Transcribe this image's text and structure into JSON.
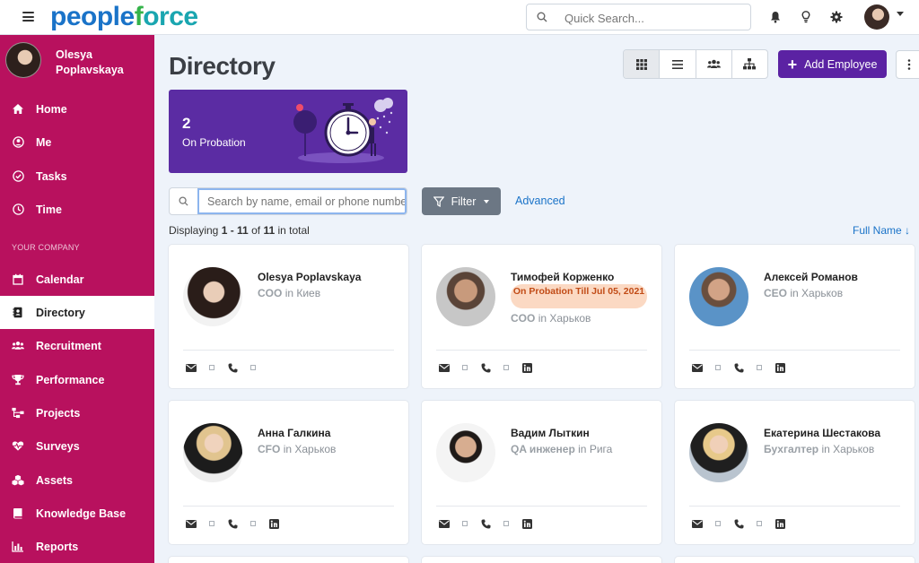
{
  "app": {
    "logo_part1": "people",
    "logo_o": "f",
    "logo_part2": "orce",
    "search_placeholder": "Quick Search..."
  },
  "sidebar": {
    "user_name": "Olesya Poplavskaya",
    "section_label": "YOUR COMPANY",
    "items": [
      {
        "label": "Home",
        "icon": "home-icon"
      },
      {
        "label": "Me",
        "icon": "user-circle-icon"
      },
      {
        "label": "Tasks",
        "icon": "check-circle-icon"
      },
      {
        "label": "Time",
        "icon": "clock-icon"
      },
      {
        "label": "Calendar",
        "icon": "calendar-icon"
      },
      {
        "label": "Directory",
        "icon": "address-book-icon",
        "active": true
      },
      {
        "label": "Recruitment",
        "icon": "users-icon"
      },
      {
        "label": "Performance",
        "icon": "trophy-icon"
      },
      {
        "label": "Projects",
        "icon": "sitemap-icon"
      },
      {
        "label": "Surveys",
        "icon": "heartbeat-icon"
      },
      {
        "label": "Assets",
        "icon": "cubes-icon"
      },
      {
        "label": "Knowledge Base",
        "icon": "book-icon"
      },
      {
        "label": "Reports",
        "icon": "bar-chart-icon"
      }
    ]
  },
  "main": {
    "title": "Directory",
    "add_employee_label": "Add Employee",
    "probation": {
      "count": "2",
      "label": "On Probation"
    },
    "search_placeholder": "Search by name, email or phone number",
    "filter_label": "Filter",
    "advanced_label": "Advanced",
    "displaying_prefix": "Displaying",
    "displaying_range": "1 - 11",
    "displaying_of": "of",
    "displaying_total": "11",
    "displaying_suffix": "in total",
    "sort_label": "Full Name ↓"
  },
  "employees": [
    {
      "name": "Olesya Poplavskaya",
      "role": "COO",
      "location": "in Киев",
      "linkedin": false
    },
    {
      "name": "Тимофей Корженко",
      "role": "COO",
      "location": "in Харьков",
      "badge": "On Probation Till Jul 05, 2021",
      "linkedin": true
    },
    {
      "name": "Алексей Романов",
      "role": "CEO",
      "location": "in Харьков",
      "linkedin": true
    },
    {
      "name": "Анна Галкина",
      "role": "CFO",
      "location": "in Харьков",
      "linkedin": true
    },
    {
      "name": "Вадим Лыткин",
      "role": "QA инженер",
      "location": "in Рига",
      "linkedin": true
    },
    {
      "name": "Екатерина Шестакова",
      "role": "Бухгалтер",
      "location": "in Харьков",
      "linkedin": true
    }
  ],
  "colors": {
    "sidebar": "#b8115e",
    "accent": "#5b22a3",
    "link": "#1a73c8",
    "badge_bg": "#fbd9c3",
    "badge_text": "#c14b16"
  }
}
